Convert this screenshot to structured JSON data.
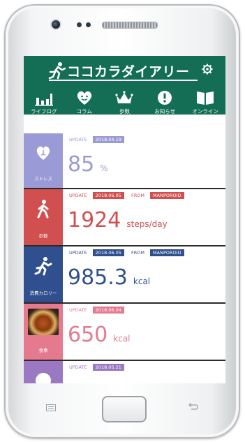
{
  "app": {
    "title": "ココカラダイアリー"
  },
  "nav": [
    {
      "label": "ライフログ",
      "icon": "bar-chart-icon"
    },
    {
      "label": "コラム",
      "icon": "heart-face-icon"
    },
    {
      "label": "歩数\nランキング",
      "icon": "crown-icon"
    },
    {
      "label": "お知らせ",
      "icon": "exclamation-icon"
    },
    {
      "label": "オンライン\n医療事典",
      "icon": "book-icon"
    }
  ],
  "cards": [
    {
      "tile_label": "ストレス",
      "update_label": "UPDATE",
      "date": "2018.04.19",
      "value": "85",
      "unit": "%",
      "color": "#9a9ad6"
    },
    {
      "tile_label": "歩数",
      "update_label": "UPDATE",
      "date": "2018.06.05",
      "from_label": "FROM",
      "source": "MANPOROID",
      "value": "1924",
      "unit": "steps/day",
      "color": "#d14f4f"
    },
    {
      "tile_label": "消費カロリー",
      "update_label": "UPDATE",
      "date": "2018.06.05",
      "from_label": "FROM",
      "source": "MANPOROID",
      "value": "985.3",
      "unit": "kcal",
      "color": "#2f4f8e"
    },
    {
      "tile_label": "食事",
      "update_label": "UPDATE",
      "date": "2018.06.04",
      "value": "650",
      "unit": "kcal",
      "color": "#e57a8f"
    },
    {
      "update_label": "UPDATE",
      "date": "2018.05.21",
      "color": "#9a78c2"
    }
  ],
  "colors": {
    "header": "#136e55",
    "stress": "#9a9ad6",
    "steps": "#d14f4f",
    "calories": "#2f4f8e",
    "meal": "#e57a8f",
    "last": "#9a78c2"
  }
}
